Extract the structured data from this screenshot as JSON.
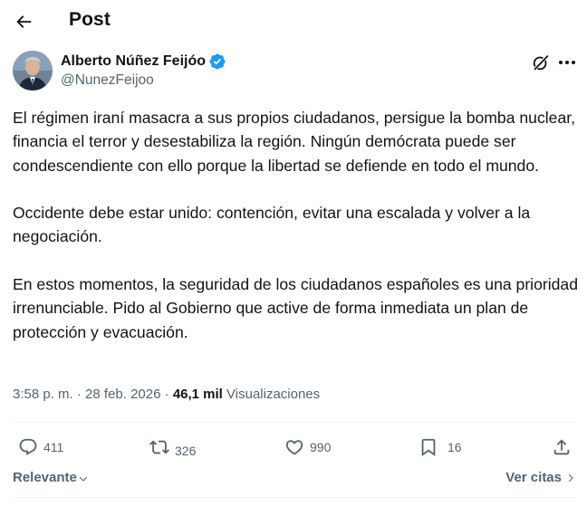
{
  "header": {
    "back_icon": "arrow-left-icon",
    "title": "Post"
  },
  "author": {
    "display_name": "Alberto Núñez Feijóo",
    "handle": "@NunezFeijoo",
    "verified": true,
    "verified_color": "#1d9bf0"
  },
  "tweet": {
    "paragraphs": [
      "El régimen iraní masacra a sus propios ciudadanos, persigue la bomba nuclear, financia el terror y desestabiliza la región. Ningún demócrata puede ser condescendiente con ello porque la libertad se defiende en todo el mundo.",
      "Occidente debe estar unido: contención, evitar una escalada y volver a la negociación.",
      "En estos momentos, la seguridad de los ciudadanos españoles es una prioridad irrenunciable. Pido al Gobierno que active de forma inmediata un plan de protección y evacuación."
    ]
  },
  "meta": {
    "time": "3:58 p. m.",
    "separator": "·",
    "date": "28 feb. 2026",
    "views_count": "46,1 mil",
    "views_label": "Visualizaciones"
  },
  "actions": {
    "replies": "411",
    "reposts": "326",
    "likes": "990",
    "bookmarks": "16"
  },
  "footer": {
    "sort_label": "Relevante",
    "quotes_label": "Ver citas"
  },
  "colors": {
    "text_primary": "#0f1419",
    "text_secondary": "#536471",
    "divider": "#eff3f4",
    "accent": "#1d9bf0"
  }
}
